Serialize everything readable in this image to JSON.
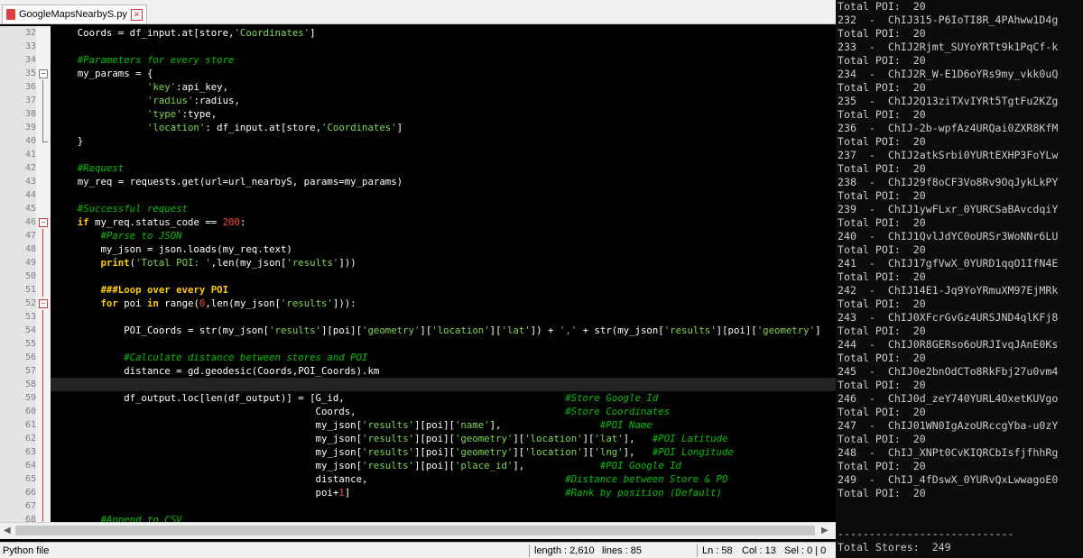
{
  "editor": {
    "tab_title": "GoogleMapsNearbyS.py",
    "lines": [
      {
        "n": "32",
        "code": [
          {
            "t": "    Coords = df_input.at[store,",
            "c": "op"
          },
          {
            "t": "'Coordinates'",
            "c": "st"
          },
          {
            "t": "]",
            "c": "op"
          }
        ]
      },
      {
        "n": "33",
        "code": []
      },
      {
        "n": "34",
        "code": [
          {
            "t": "    #Parameters for every store",
            "c": "cm"
          }
        ]
      },
      {
        "n": "35",
        "code": [
          {
            "t": "    my_params = {",
            "c": "op"
          }
        ]
      },
      {
        "n": "36",
        "code": [
          {
            "t": "                ",
            "c": "op"
          },
          {
            "t": "'key'",
            "c": "st"
          },
          {
            "t": ":api_key,",
            "c": "op"
          }
        ]
      },
      {
        "n": "37",
        "code": [
          {
            "t": "                ",
            "c": "op"
          },
          {
            "t": "'radius'",
            "c": "st"
          },
          {
            "t": ":radius,",
            "c": "op"
          }
        ]
      },
      {
        "n": "38",
        "code": [
          {
            "t": "                ",
            "c": "op"
          },
          {
            "t": "'type'",
            "c": "st"
          },
          {
            "t": ":type,",
            "c": "op"
          }
        ]
      },
      {
        "n": "39",
        "code": [
          {
            "t": "                ",
            "c": "op"
          },
          {
            "t": "'location'",
            "c": "st"
          },
          {
            "t": ": df_input.at[store,",
            "c": "op"
          },
          {
            "t": "'Coordinates'",
            "c": "st"
          },
          {
            "t": "]",
            "c": "op"
          }
        ]
      },
      {
        "n": "40",
        "code": [
          {
            "t": "    }",
            "c": "op"
          }
        ]
      },
      {
        "n": "41",
        "code": []
      },
      {
        "n": "42",
        "code": [
          {
            "t": "    #Request",
            "c": "cm"
          }
        ]
      },
      {
        "n": "43",
        "code": [
          {
            "t": "    my_req = requests.get(url=url_nearbyS, params=my_params)",
            "c": "op"
          }
        ]
      },
      {
        "n": "44",
        "code": []
      },
      {
        "n": "45",
        "code": [
          {
            "t": "    #Successful request",
            "c": "cm"
          }
        ]
      },
      {
        "n": "46",
        "code": [
          {
            "t": "    ",
            "c": "op"
          },
          {
            "t": "if",
            "c": "kw"
          },
          {
            "t": " my_req.status_code == ",
            "c": "op"
          },
          {
            "t": "200",
            "c": "nm"
          },
          {
            "t": ":",
            "c": "op"
          }
        ]
      },
      {
        "n": "47",
        "code": [
          {
            "t": "        #Parse to JSON",
            "c": "cm"
          }
        ]
      },
      {
        "n": "48",
        "code": [
          {
            "t": "        my_json = json.loads(my_req.text)",
            "c": "op"
          }
        ]
      },
      {
        "n": "49",
        "code": [
          {
            "t": "        ",
            "c": "op"
          },
          {
            "t": "print",
            "c": "kw"
          },
          {
            "t": "(",
            "c": "op"
          },
          {
            "t": "'Total POI: '",
            "c": "st"
          },
          {
            "t": ",len(my_json[",
            "c": "op"
          },
          {
            "t": "'results'",
            "c": "st"
          },
          {
            "t": "]))",
            "c": "op"
          }
        ]
      },
      {
        "n": "50",
        "code": []
      },
      {
        "n": "51",
        "code": [
          {
            "t": "        ###Loop over every POI",
            "c": "kw"
          }
        ]
      },
      {
        "n": "52",
        "code": [
          {
            "t": "        ",
            "c": "op"
          },
          {
            "t": "for",
            "c": "kw"
          },
          {
            "t": " poi ",
            "c": "op"
          },
          {
            "t": "in",
            "c": "kw"
          },
          {
            "t": " range(",
            "c": "op"
          },
          {
            "t": "0",
            "c": "nm"
          },
          {
            "t": ",len(my_json[",
            "c": "op"
          },
          {
            "t": "'results'",
            "c": "st"
          },
          {
            "t": "])):",
            "c": "op"
          }
        ]
      },
      {
        "n": "53",
        "code": []
      },
      {
        "n": "54",
        "code": [
          {
            "t": "            POI_Coords = str(my_json[",
            "c": "op"
          },
          {
            "t": "'results'",
            "c": "st"
          },
          {
            "t": "][poi][",
            "c": "op"
          },
          {
            "t": "'geometry'",
            "c": "st"
          },
          {
            "t": "][",
            "c": "op"
          },
          {
            "t": "'location'",
            "c": "st"
          },
          {
            "t": "][",
            "c": "op"
          },
          {
            "t": "'lat'",
            "c": "st"
          },
          {
            "t": "]) + ",
            "c": "op"
          },
          {
            "t": "','",
            "c": "st"
          },
          {
            "t": " + str(my_json[",
            "c": "op"
          },
          {
            "t": "'results'",
            "c": "st"
          },
          {
            "t": "][poi][",
            "c": "op"
          },
          {
            "t": "'geometry'",
            "c": "st"
          },
          {
            "t": "]",
            "c": "op"
          }
        ]
      },
      {
        "n": "55",
        "code": []
      },
      {
        "n": "56",
        "code": [
          {
            "t": "            #Calculate distance between stores and POI",
            "c": "cm"
          }
        ]
      },
      {
        "n": "57",
        "code": [
          {
            "t": "            distance = gd.geodesic(Coords,POI_Coords).km",
            "c": "op"
          }
        ]
      },
      {
        "n": "58",
        "code": []
      },
      {
        "n": "59",
        "code": [
          {
            "t": "            df_output.loc[len(df_output)] = [G_id,                                      ",
            "c": "op"
          },
          {
            "t": "#Store Google Id",
            "c": "cm"
          }
        ]
      },
      {
        "n": "60",
        "code": [
          {
            "t": "                                             Coords,                                    ",
            "c": "op"
          },
          {
            "t": "#Store Coordinates",
            "c": "cm"
          }
        ]
      },
      {
        "n": "61",
        "code": [
          {
            "t": "                                             my_json[",
            "c": "op"
          },
          {
            "t": "'results'",
            "c": "st"
          },
          {
            "t": "][poi][",
            "c": "op"
          },
          {
            "t": "'name'",
            "c": "st"
          },
          {
            "t": "],                 ",
            "c": "op"
          },
          {
            "t": "#POI Name",
            "c": "cm"
          }
        ]
      },
      {
        "n": "62",
        "code": [
          {
            "t": "                                             my_json[",
            "c": "op"
          },
          {
            "t": "'results'",
            "c": "st"
          },
          {
            "t": "][poi][",
            "c": "op"
          },
          {
            "t": "'geometry'",
            "c": "st"
          },
          {
            "t": "][",
            "c": "op"
          },
          {
            "t": "'location'",
            "c": "st"
          },
          {
            "t": "][",
            "c": "op"
          },
          {
            "t": "'lat'",
            "c": "st"
          },
          {
            "t": "],   ",
            "c": "op"
          },
          {
            "t": "#POI Latitude",
            "c": "cm"
          }
        ]
      },
      {
        "n": "63",
        "code": [
          {
            "t": "                                             my_json[",
            "c": "op"
          },
          {
            "t": "'results'",
            "c": "st"
          },
          {
            "t": "][poi][",
            "c": "op"
          },
          {
            "t": "'geometry'",
            "c": "st"
          },
          {
            "t": "][",
            "c": "op"
          },
          {
            "t": "'location'",
            "c": "st"
          },
          {
            "t": "][",
            "c": "op"
          },
          {
            "t": "'lng'",
            "c": "st"
          },
          {
            "t": "],   ",
            "c": "op"
          },
          {
            "t": "#POI Longitude",
            "c": "cm"
          }
        ]
      },
      {
        "n": "64",
        "code": [
          {
            "t": "                                             my_json[",
            "c": "op"
          },
          {
            "t": "'results'",
            "c": "st"
          },
          {
            "t": "][poi][",
            "c": "op"
          },
          {
            "t": "'place_id'",
            "c": "st"
          },
          {
            "t": "],             ",
            "c": "op"
          },
          {
            "t": "#POI Google Id",
            "c": "cm"
          }
        ]
      },
      {
        "n": "65",
        "code": [
          {
            "t": "                                             distance,                                  ",
            "c": "op"
          },
          {
            "t": "#Distance between Store & PO",
            "c": "cm"
          }
        ]
      },
      {
        "n": "66",
        "code": [
          {
            "t": "                                             poi+",
            "c": "op"
          },
          {
            "t": "1",
            "c": "nm"
          },
          {
            "t": "]                                     ",
            "c": "op"
          },
          {
            "t": "#Rank by position (Default)",
            "c": "cm"
          }
        ]
      },
      {
        "n": "67",
        "code": []
      },
      {
        "n": "68",
        "code": [
          {
            "t": "        #Append to CSV",
            "c": "cm"
          }
        ]
      }
    ]
  },
  "status": {
    "file_type": "Python file",
    "length": "length : 2,610",
    "lines": "lines : 85",
    "ln": "Ln : 58",
    "col": "Col : 13",
    "sel": "Sel : 0 | 0"
  },
  "console": {
    "lines": [
      "Total POI:  20",
      "232  -  ChIJ315-P6IoTI8R_4PAhww1D4g",
      "Total POI:  20",
      "233  -  ChIJ2Rjmt_SUYoYRTt9k1PqCf-k",
      "Total POI:  20",
      "234  -  ChIJ2R_W-E1D6oYRs9my_vkk0uQ",
      "Total POI:  20",
      "235  -  ChIJ2Q13ziTXvIYRt5TgtFu2KZg",
      "Total POI:  20",
      "236  -  ChIJ-2b-wpfAz4URQai0ZXR8KfM",
      "Total POI:  20",
      "237  -  ChIJ2atkSrbi0YURtEXHP3FoYLw",
      "Total POI:  20",
      "238  -  ChIJ29f8oCF3Vo8Rv9OqJykLkPY",
      "Total POI:  20",
      "239  -  ChIJ1ywFLxr_0YURCSaBAvcdqiY",
      "Total POI:  20",
      "240  -  ChIJ1QvlJdYC0oURSr3WoNNr6LU",
      "Total POI:  20",
      "241  -  ChIJ17gfVwX_0YURD1qqO1IfN4E",
      "Total POI:  20",
      "242  -  ChIJ14E1-Jq9YoYRmuXM97EjMRk",
      "Total POI:  20",
      "243  -  ChIJ0XFcrGvGz4URSJND4qlKFj8",
      "Total POI:  20",
      "244  -  ChIJ0R8GERso6oURJIvqJAnE0Ks",
      "Total POI:  20",
      "245  -  ChIJ0e2bnOdCTo8RkFbj27u0vm4",
      "Total POI:  20",
      "246  -  ChIJ0d_zeY740YURL4OxetKUVgo",
      "Total POI:  20",
      "247  -  ChIJ01WN0IgAzoURccgYba-u0zY",
      "Total POI:  20",
      "248  -  ChIJ_XNPt0CvKIQRCbIsfjfhhRg",
      "Total POI:  20",
      "249  -  ChIJ_4fDswX_0YURvQxLwwagoE0",
      "Total POI:  20",
      "",
      "",
      "----------------------------",
      "Total Stores:  249"
    ]
  },
  "colors": {
    "editor_bg": "#000000",
    "keyword": "#ffcc00",
    "string": "#7fd94f",
    "comment": "#00c000",
    "number": "#ff4040",
    "console_bg": "#0c0c0c",
    "console_text": "#cccccc"
  }
}
